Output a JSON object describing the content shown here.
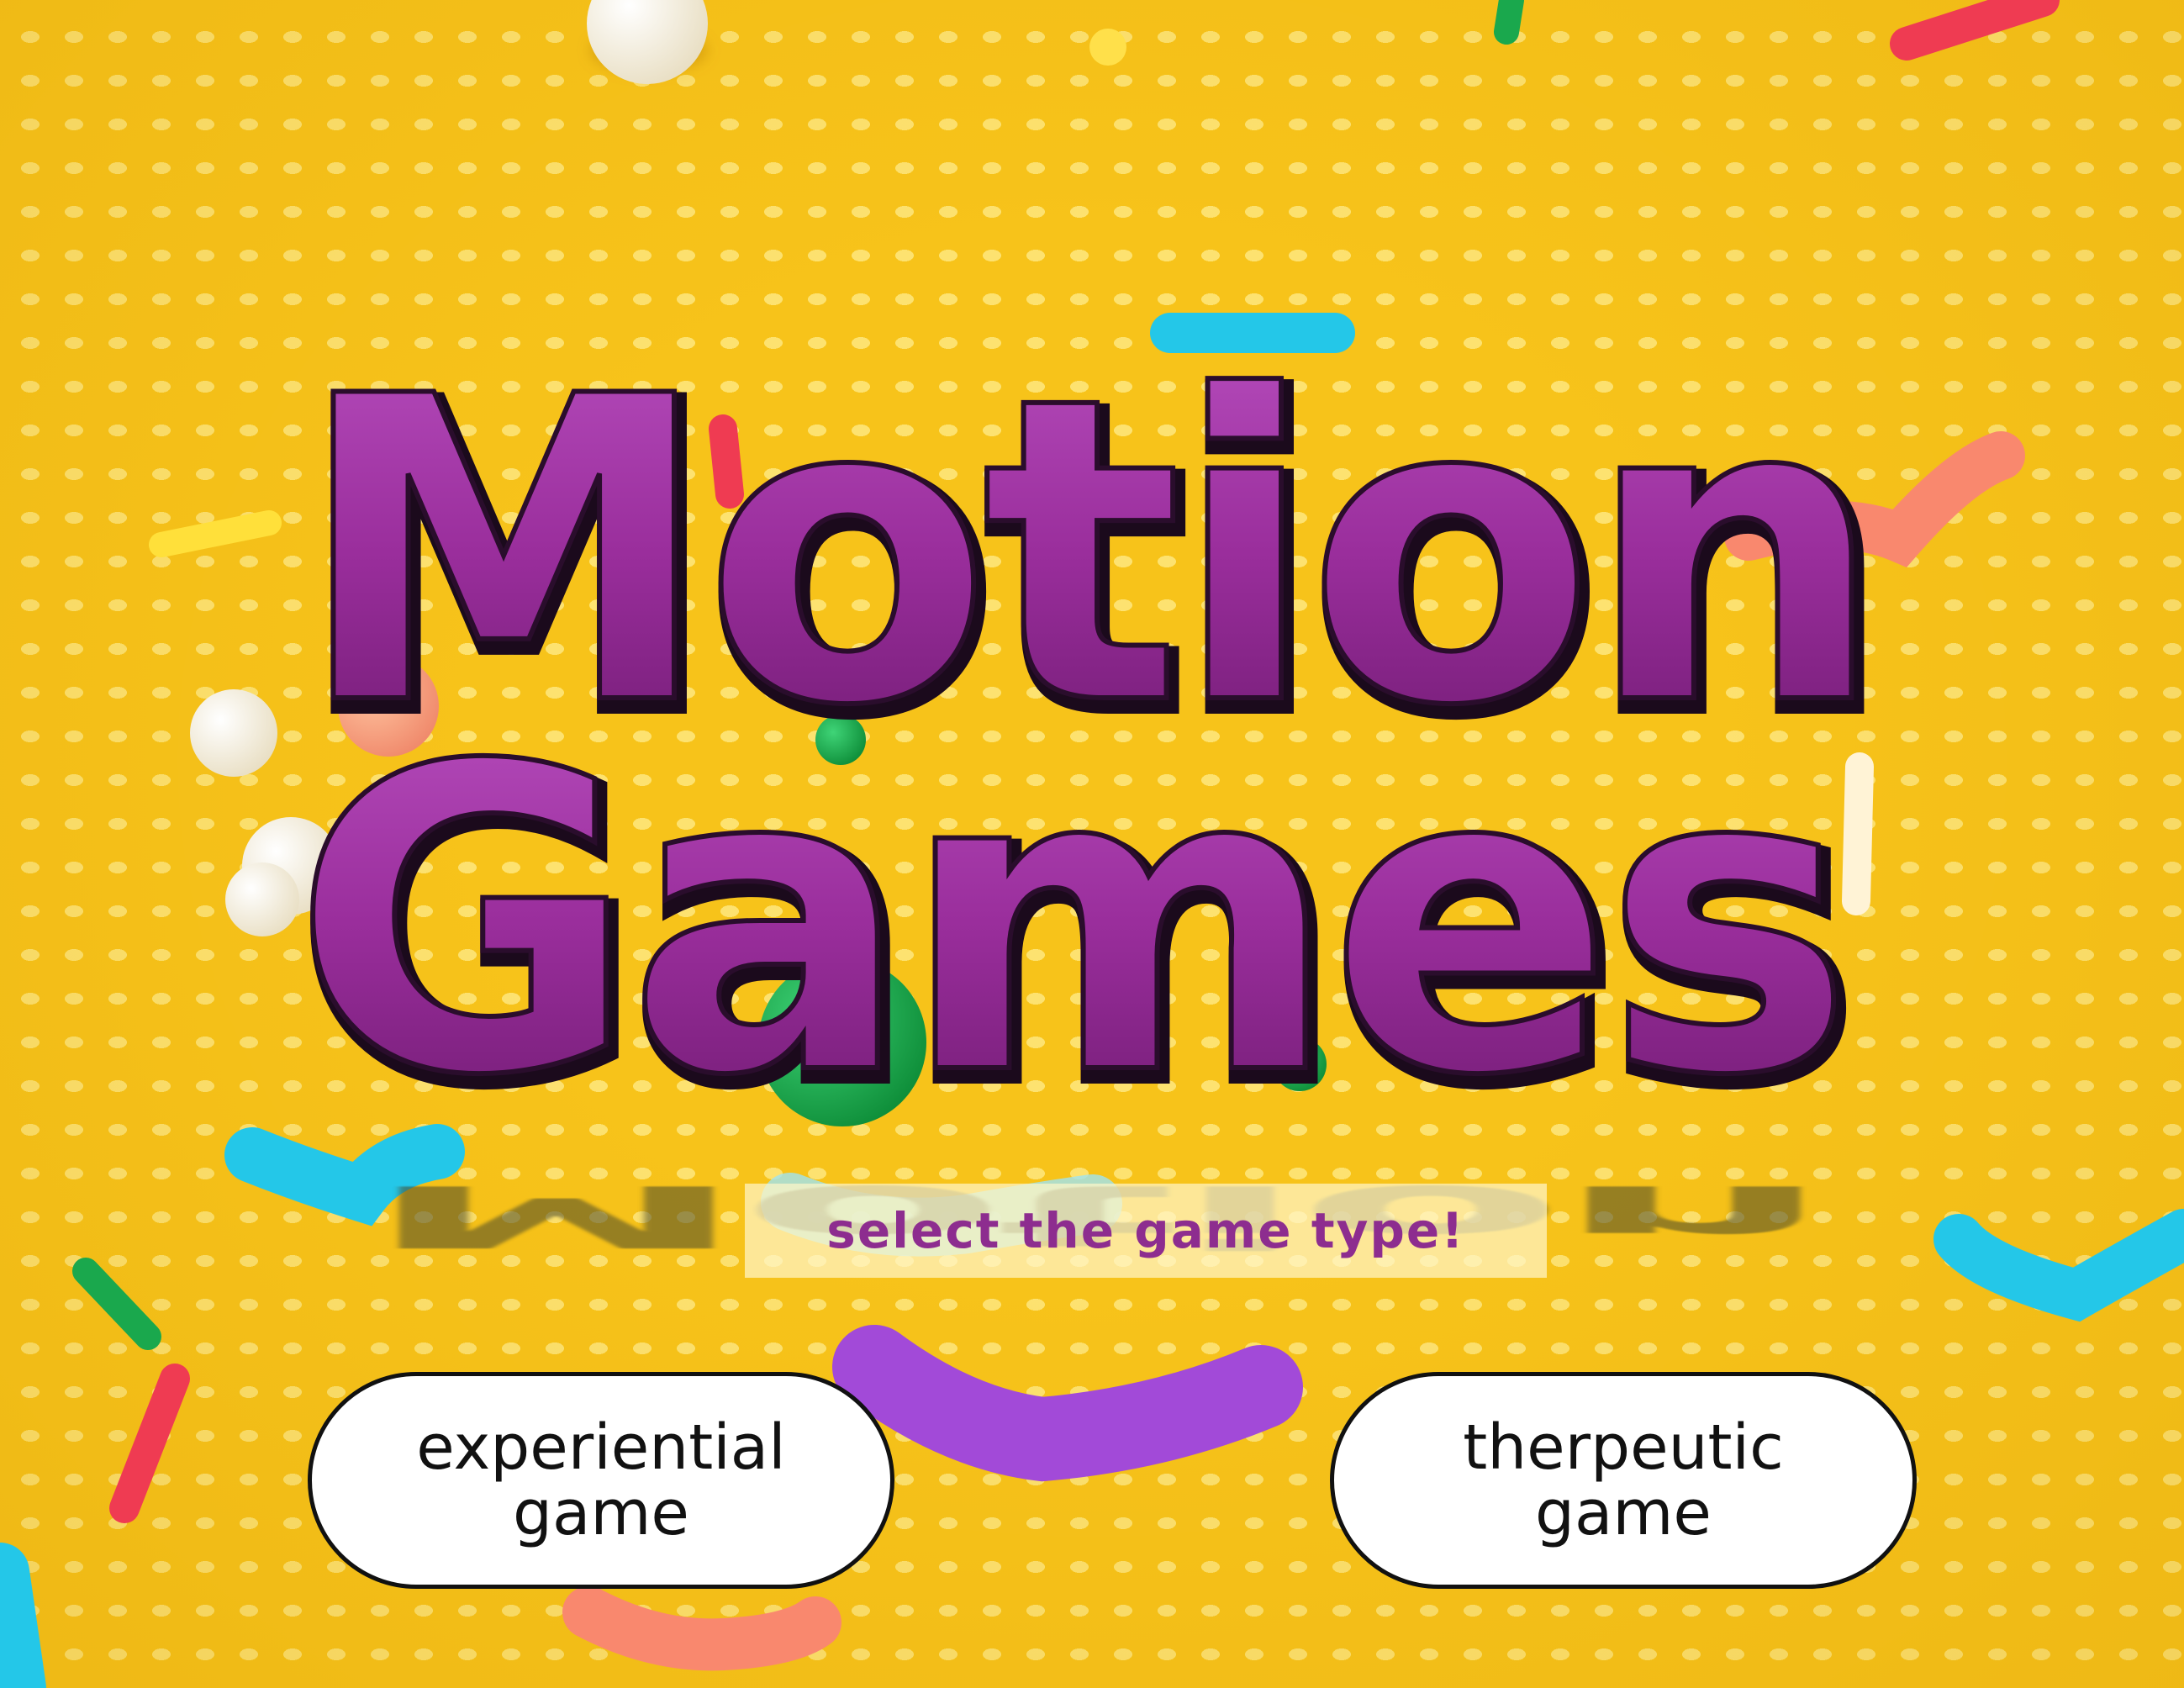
{
  "screen": {
    "title_line1": "Motion",
    "title_line2": "Games",
    "subtitle": "select the game type!"
  },
  "buttons": {
    "experiential": {
      "line1": "experiential",
      "line2": "game"
    },
    "therapeutic": {
      "line1": "therpeutic",
      "line2": "game"
    }
  },
  "colors": {
    "background": "#f7c31a",
    "title": "#9a2e9c",
    "subtitle": "#8d2d8f",
    "button_fill": "#ffffff",
    "button_border": "#111111"
  }
}
